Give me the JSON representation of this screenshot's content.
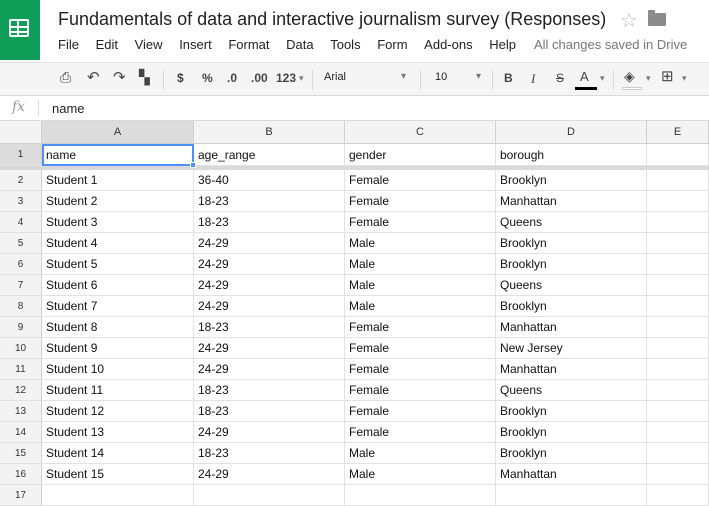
{
  "app": {
    "title": "Fundamentals of data and interactive journalism survey (Responses)",
    "saved_status": "All changes saved in Drive",
    "brand_color": "#0f9d58"
  },
  "menu": [
    "File",
    "Edit",
    "View",
    "Insert",
    "Format",
    "Data",
    "Tools",
    "Form",
    "Add-ons",
    "Help"
  ],
  "toolbar": {
    "currency": "$",
    "percent": "%",
    "decrease_decimal": ".0",
    "increase_decimal": ".00",
    "more_formats": "123",
    "font": "Arial",
    "font_size": "10",
    "bold": "B",
    "italic": "I",
    "strike": "S",
    "text_color": "A"
  },
  "formula_bar": {
    "fx_label": "fx",
    "value": "name"
  },
  "sheet": {
    "columns": [
      "A",
      "B",
      "C",
      "D",
      "E"
    ],
    "row_numbers": [
      "1",
      "2",
      "3",
      "4",
      "5",
      "6",
      "7",
      "8",
      "9",
      "10",
      "11",
      "12",
      "13",
      "14",
      "15",
      "16",
      "17"
    ],
    "header": [
      "name",
      "age_range",
      "gender",
      "borough"
    ],
    "rows": [
      [
        "Student 1",
        "36-40",
        "Female",
        "Brooklyn"
      ],
      [
        "Student 2",
        "18-23",
        "Female",
        "Manhattan"
      ],
      [
        "Student 3",
        "18-23",
        "Female",
        "Queens"
      ],
      [
        "Student 4",
        "24-29",
        "Male",
        "Brooklyn"
      ],
      [
        "Student 5",
        "24-29",
        "Male",
        "Brooklyn"
      ],
      [
        "Student 6",
        "24-29",
        "Male",
        "Queens"
      ],
      [
        "Student 7",
        "24-29",
        "Male",
        "Brooklyn"
      ],
      [
        "Student 8",
        "18-23",
        "Female",
        "Manhattan"
      ],
      [
        "Student 9",
        "24-29",
        "Female",
        "New Jersey"
      ],
      [
        "Student 10",
        "24-29",
        "Female",
        "Manhattan"
      ],
      [
        "Student 11",
        "18-23",
        "Female",
        "Queens"
      ],
      [
        "Student 12",
        "18-23",
        "Female",
        "Brooklyn"
      ],
      [
        "Student 13",
        "24-29",
        "Female",
        "Brooklyn"
      ],
      [
        "Student 14",
        "18-23",
        "Male",
        "Brooklyn"
      ],
      [
        "Student 15",
        "24-29",
        "Male",
        "Manhattan"
      ]
    ]
  }
}
